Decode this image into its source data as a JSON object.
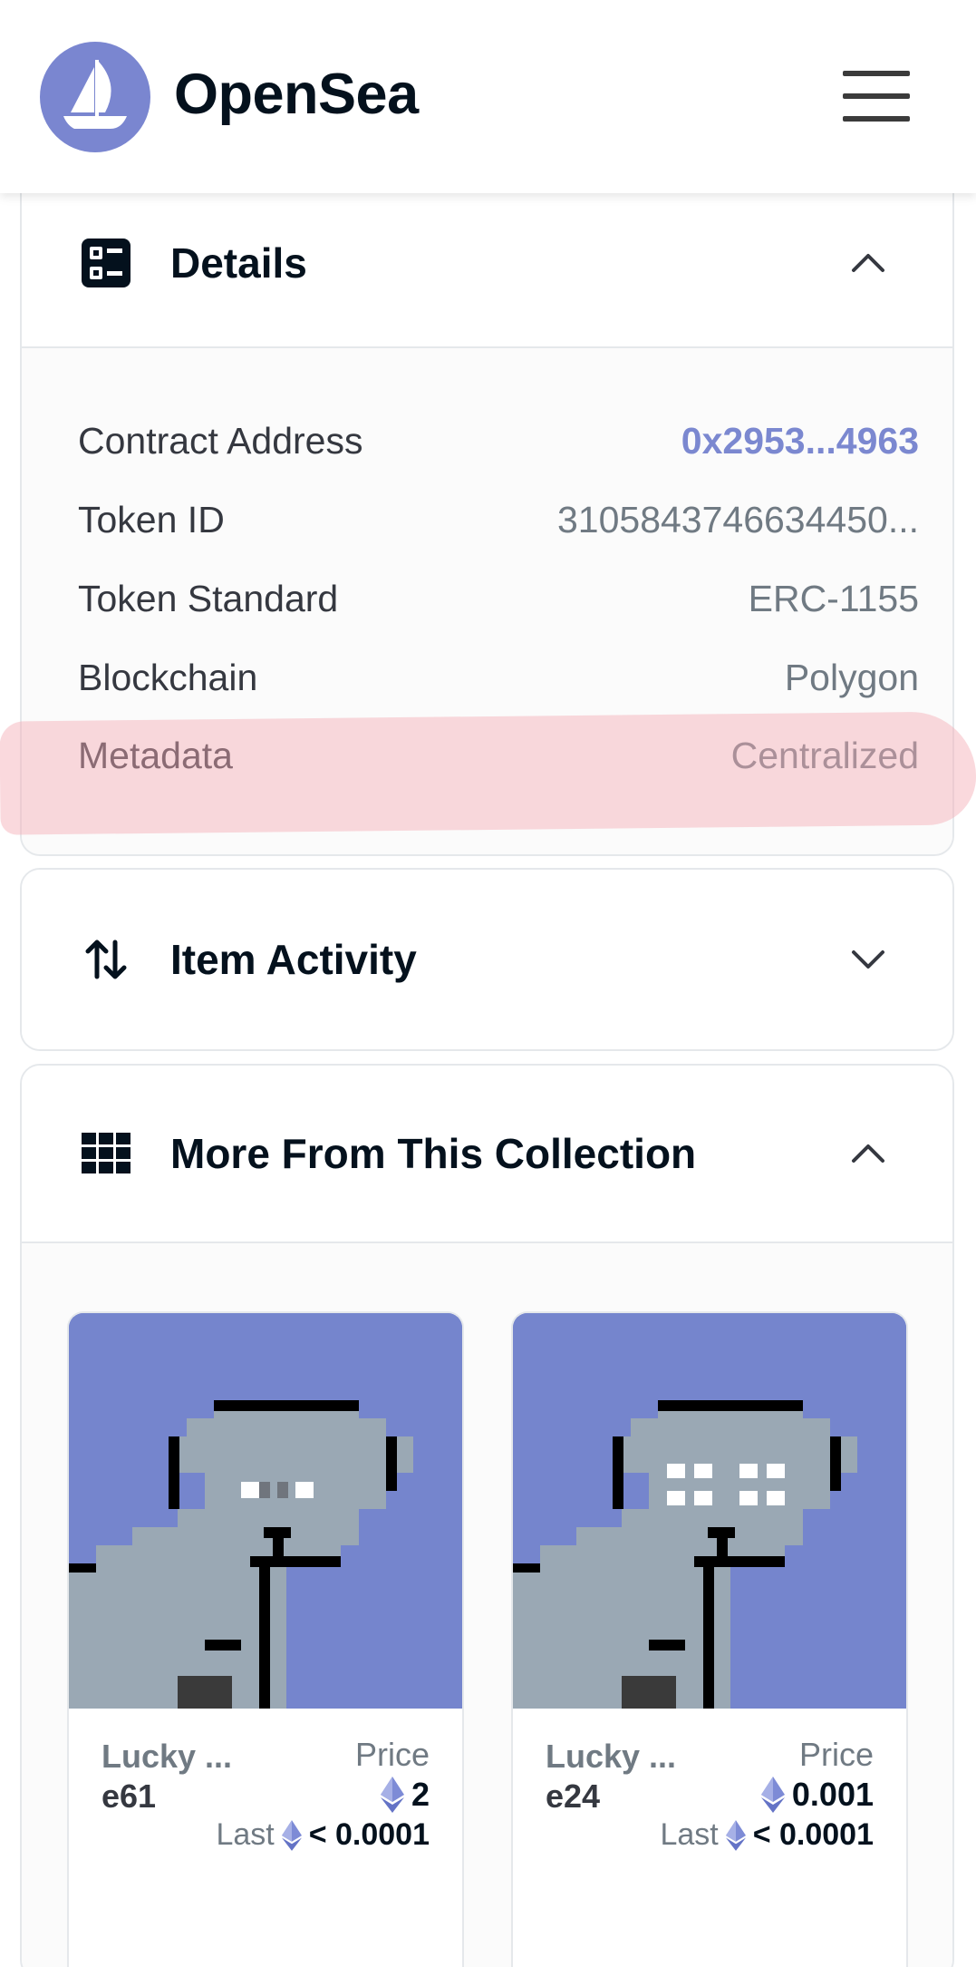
{
  "header": {
    "brand": "OpenSea",
    "logo_icon": "opensea-boat-icon",
    "menu_icon": "hamburger-menu-icon",
    "accent": "#7a86d0"
  },
  "details": {
    "title": "Details",
    "icon": "details-list-icon",
    "chevron": "chevron-up-icon",
    "rows": [
      {
        "label": "Contract Address",
        "value": "0x2953...4963"
      },
      {
        "label": "Token ID",
        "value": "3105843746634450..."
      },
      {
        "label": "Token Standard",
        "value": "ERC-1155"
      },
      {
        "label": "Blockchain",
        "value": "Polygon"
      },
      {
        "label": "Metadata",
        "value": "Centralized"
      }
    ]
  },
  "activity": {
    "title": "Item Activity",
    "icon": "swap-vertical-arrows-icon",
    "chevron": "chevron-down-icon"
  },
  "collection": {
    "title": "More From This Collection",
    "icon": "grid-icon",
    "chevron": "chevron-up-icon",
    "items": [
      {
        "name_line1": "Lucky ...",
        "name_line2": "e61",
        "price_label": "Price",
        "price": "2",
        "last_label": "Last",
        "last_value": "< 0.0001"
      },
      {
        "name_line1": "Lucky ...",
        "name_line2": "e24",
        "price_label": "Price",
        "price": "0.001",
        "last_label": "Last",
        "last_value": "< 0.0001"
      }
    ]
  }
}
